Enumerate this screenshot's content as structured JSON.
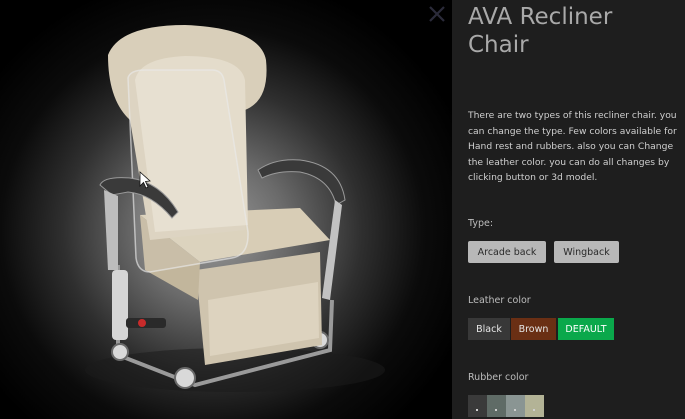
{
  "product": {
    "title": "AVA Recliner Chair",
    "description": "There are two types of this recliner chair. you can change the type. Few colors available for Hand rest and rubbers. also you can Change the leather color. you can do all changes by clicking button or 3d model."
  },
  "type": {
    "label": "Type:",
    "options": [
      "Arcade back",
      "Wingback"
    ]
  },
  "leather": {
    "label": "Leather color",
    "options": [
      "Black",
      "Brown",
      "DEFAULT"
    ],
    "colors": [
      "#383838",
      "#6a2f14",
      "#0aa84b"
    ]
  },
  "rubber": {
    "label": "Rubber color",
    "swatch_colors": [
      "#3a3a3a",
      "#5f6b66",
      "#8a9593",
      "#b3b396"
    ]
  },
  "icons": {
    "close": "close-icon",
    "cursor": "mouse-pointer-icon"
  }
}
